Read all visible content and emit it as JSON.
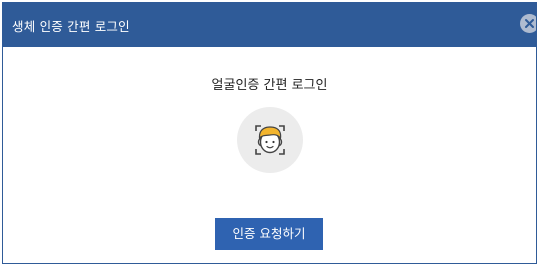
{
  "dialog": {
    "title": "생체 인증 간편 로그인",
    "close_icon": "close-icon"
  },
  "main": {
    "heading": "얼굴인증 간편 로그인",
    "illustration_icon": "face-scan-icon"
  },
  "actions": {
    "request_label": "인증 요청하기"
  },
  "colors": {
    "title_bar": "#2f5b98",
    "button": "#2f63b1",
    "hair": "#f3b52e",
    "icon_circle": "#ececec"
  }
}
